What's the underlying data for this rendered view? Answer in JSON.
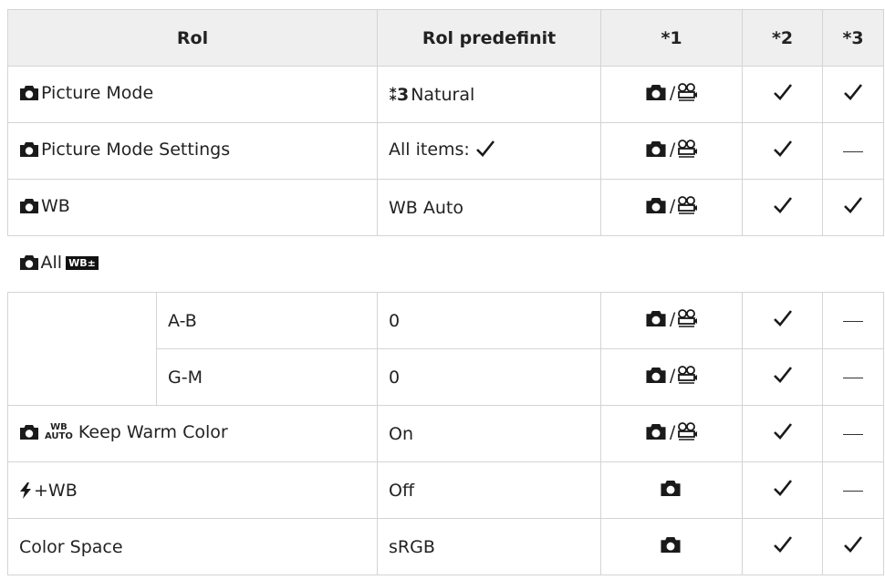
{
  "headers": [
    "Rol",
    "Rol predefinit",
    "*1",
    "*2",
    "*3"
  ],
  "rows": {
    "picture_mode": {
      "label": "Picture Mode",
      "default_icon": "picture-mode-natural-icon",
      "default_prefix": "3",
      "default": "Natural",
      "c1": "photo/movie",
      "c2": "check",
      "c3": "check"
    },
    "picture_mode_settings": {
      "label": "Picture Mode Settings",
      "default": "All items:",
      "default_suffix": "check",
      "c1": "photo/movie",
      "c2": "check",
      "c3": "dash"
    },
    "wb": {
      "label": "WB",
      "default": "WB Auto",
      "c1": "photo/movie",
      "c2": "check",
      "c3": "check"
    },
    "all_wb": {
      "label": "All",
      "badge": "WB±"
    },
    "ab": {
      "label": "A-B",
      "default": "0",
      "c1": "photo/movie",
      "c2": "check",
      "c3": "dash"
    },
    "gm": {
      "label": "G-M",
      "default": "0",
      "c1": "photo/movie",
      "c2": "check",
      "c3": "dash"
    },
    "keep_warm": {
      "badge_top": "WB",
      "badge_bottom": "AUTO",
      "label": "Keep Warm Color",
      "default": "On",
      "c1": "photo/movie",
      "c2": "check",
      "c3": "dash"
    },
    "flash_wb": {
      "label": "+WB",
      "default": "Off",
      "c1": "photo",
      "c2": "check",
      "c3": "dash"
    },
    "color_space": {
      "label": "Color Space",
      "default": "sRGB",
      "c1": "photo",
      "c2": "check",
      "c3": "check"
    }
  },
  "colors": {
    "header_bg": "#efefef",
    "border": "#d4d4d4",
    "text": "#222222"
  }
}
